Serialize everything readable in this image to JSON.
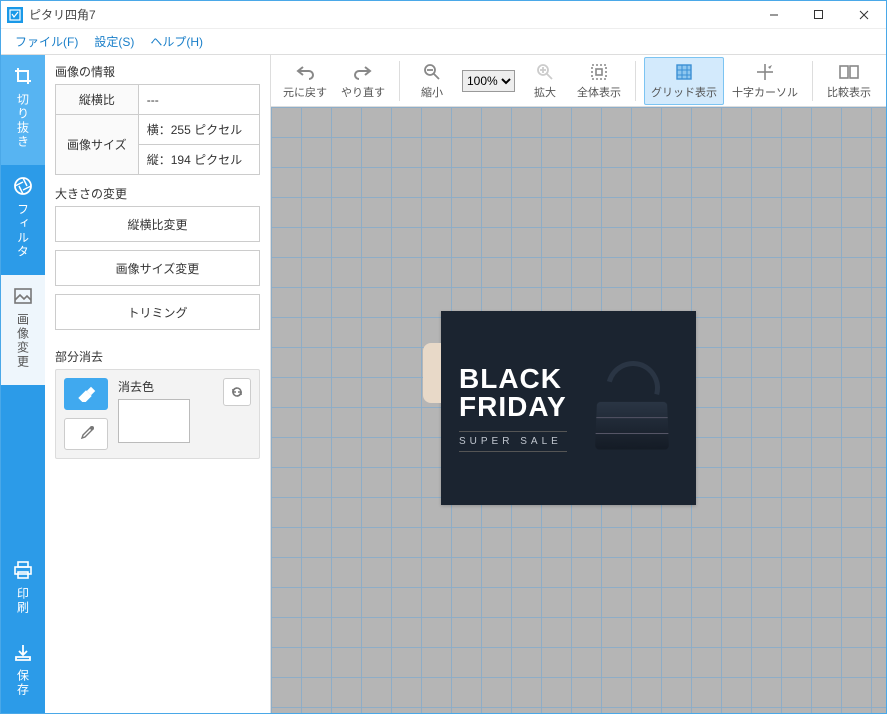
{
  "window": {
    "title": "ピタリ四角7"
  },
  "menu": {
    "file": "ファイル(F)",
    "settings": "設定(S)",
    "help": "ヘルプ(H)"
  },
  "vtabs": {
    "crop": "切り抜き",
    "filter": "フィルタ",
    "modify": "画像変更",
    "print": "印刷",
    "save": "保存"
  },
  "panel": {
    "info_title": "画像の情報",
    "aspect_label": "縦横比",
    "aspect_value": "---",
    "size_label": "画像サイズ",
    "width_text": "横：255 ピクセル",
    "height_text": "縦：194 ピクセル",
    "resize_title": "大きさの変更",
    "btn_aspect": "縦横比変更",
    "btn_size": "画像サイズ変更",
    "btn_trim": "トリミング",
    "erase_title": "部分消去",
    "erase_color_label": "消去色"
  },
  "toolbar": {
    "undo": "元に戻す",
    "redo": "やり直す",
    "zoom_out": "縮小",
    "zoom_value": "100%",
    "zoom_in": "拡大",
    "fit": "全体表示",
    "grid": "グリッド表示",
    "crosshair": "十字カーソル",
    "compare": "比較表示"
  },
  "image_content": {
    "line1": "BLACK",
    "line2": "FRIDAY",
    "tag": "SUPER SALE"
  }
}
